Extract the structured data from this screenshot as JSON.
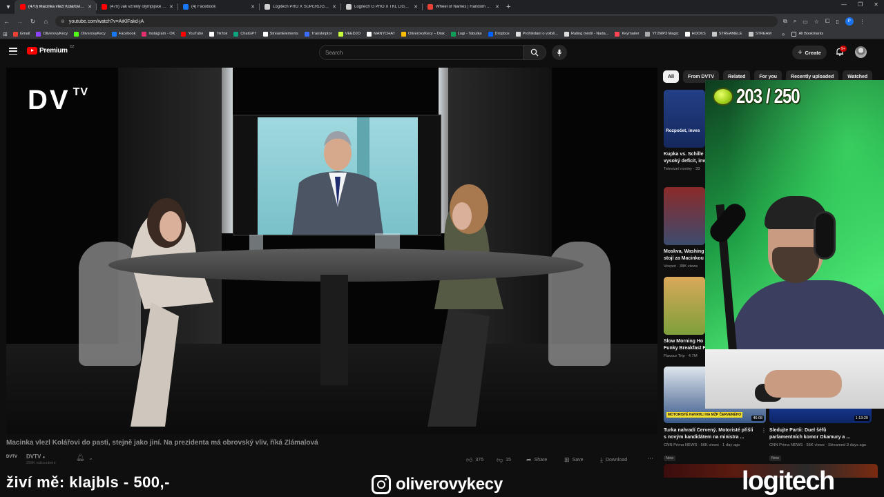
{
  "browser": {
    "tabs": [
      {
        "title": "(470) Macinka vlezl Kolářovi do",
        "favicon_color": "#ff0000",
        "active": true
      },
      {
        "title": "(470) Jak vznikly olympijské hry",
        "favicon_color": "#ff0000",
        "active": false
      },
      {
        "title": "(4) Facebook",
        "favicon_color": "#1877f2",
        "active": false
      },
      {
        "title": "Logitech PRO X SUPERLIGHT 2",
        "favicon_color": "#cfcfcf",
        "active": false
      },
      {
        "title": "Logitech G PRO X TKL LIGHTSP",
        "favicon_color": "#cfcfcf",
        "active": false
      },
      {
        "title": "Wheel of Names | Random nam",
        "favicon_color": "#e94235",
        "active": false
      }
    ],
    "url": "youtube.com/watch?v=AiKlFakd-jA",
    "bookmarks": [
      {
        "label": "Gmail",
        "color": "#ea4335"
      },
      {
        "label": "OliverovyKecy",
        "color": "#8e44ff"
      },
      {
        "label": "OliverovyKecy",
        "color": "#53fc18"
      },
      {
        "label": "Facebook",
        "color": "#1877f2"
      },
      {
        "label": "Instagram - OK",
        "color": "#e1306c"
      },
      {
        "label": "YouTube",
        "color": "#ff0000"
      },
      {
        "label": "TikTok",
        "color": "#ffffff"
      },
      {
        "label": "ChatGPT",
        "color": "#10a37f"
      },
      {
        "label": "StreamElements",
        "color": "#ffffff"
      },
      {
        "label": "Transkriptor",
        "color": "#3b6cff"
      },
      {
        "label": "VEEDJO",
        "color": "#c7ff3d"
      },
      {
        "label": "MANYCHAT",
        "color": "#ffffff"
      },
      {
        "label": "OliverovyKecy – Disk",
        "color": "#fbbc04"
      },
      {
        "label": "Logi - Tabulka",
        "color": "#0f9d58"
      },
      {
        "label": "Dropbox",
        "color": "#0061ff"
      },
      {
        "label": "Prohlédání o volbě...",
        "color": "#dddddd"
      },
      {
        "label": "Rating médií - Nada...",
        "color": "#dddddd"
      },
      {
        "label": "Keymailer",
        "color": "#ff4455"
      },
      {
        "label": "YT2MP3 Magic",
        "color": "#aaaaaa"
      },
      {
        "label": "HOOKS",
        "color": "#ffffff"
      },
      {
        "label": "STREAMELE",
        "color": "#c4c7c5"
      },
      {
        "label": "STREAM",
        "color": "#c4c7c5"
      }
    ],
    "all_bookmarks_label": "All Bookmarks"
  },
  "youtube": {
    "logo_text": "Premium",
    "country_code": "CZ",
    "search_placeholder": "Search",
    "create_label": "Create",
    "notification_count": "9+"
  },
  "video": {
    "overlay_logo_main": "DV",
    "overlay_logo_sup": "TV",
    "title": "Macinka vlezl Kolářovi do pasti, stejně jako jiní. Na prezidenta má obrovský vliv, říká Zlámalová",
    "channel_badge": "DVTV",
    "channel_name": "DVTV",
    "subscribers": "299K subscribers",
    "likes": "375",
    "dislikes": "15",
    "share_label": "Share",
    "save_label": "Save",
    "download_label": "Download"
  },
  "chips": [
    "All",
    "From DVTV",
    "Related",
    "For you",
    "Recently uploaded",
    "Watched"
  ],
  "recommendations": [
    {
      "title1": "Kupka vs. Schille",
      "title2": "vysoký deficit, inv",
      "meta": "Televizní noviny · 33",
      "thumb_overlay": "Rozpočet, inves",
      "thumb_color": "#1e3f8a"
    },
    {
      "title1": "Moskva, Washing",
      "title2": "stojí za Macinkou",
      "meta": "Voxpot · 38K views",
      "thumb_color": "#7a1a1a"
    },
    {
      "title1": "Slow Morning Ho",
      "title2": "Funky Breakfast F",
      "meta": "Flavour Trip · 4.7M",
      "thumb_color": "#d1a34e"
    },
    {
      "title1": "Turka nahradí Červený. Motoristé přišli",
      "title2": "s novým kandidátem na ministra ...",
      "meta": "CNN Prima NEWS · 56K views · 1 day ago",
      "badge": "New",
      "duration": "46:08",
      "thumb_overlay": "MOTORISTÉ NAVRHLI NA MŽP ČERVENÉHO",
      "thumb_color": "#2b4a7a"
    },
    {
      "title1": "Sledujte Partii: Duel šéfů",
      "title2": "parlamentních komor Okamury a ...",
      "meta": "CNN Prima NEWS · 55K views · Streamed 3 days ago",
      "badge": "New",
      "duration": "1:13:29",
      "thumb_color": "#1b3f9c"
    }
  ],
  "stream_overlay": {
    "counter": "203 / 250",
    "donor_line": "živí mě: klajbls - 500,-",
    "instagram_handle": "oliverovykecy",
    "sponsor": "logitech"
  }
}
